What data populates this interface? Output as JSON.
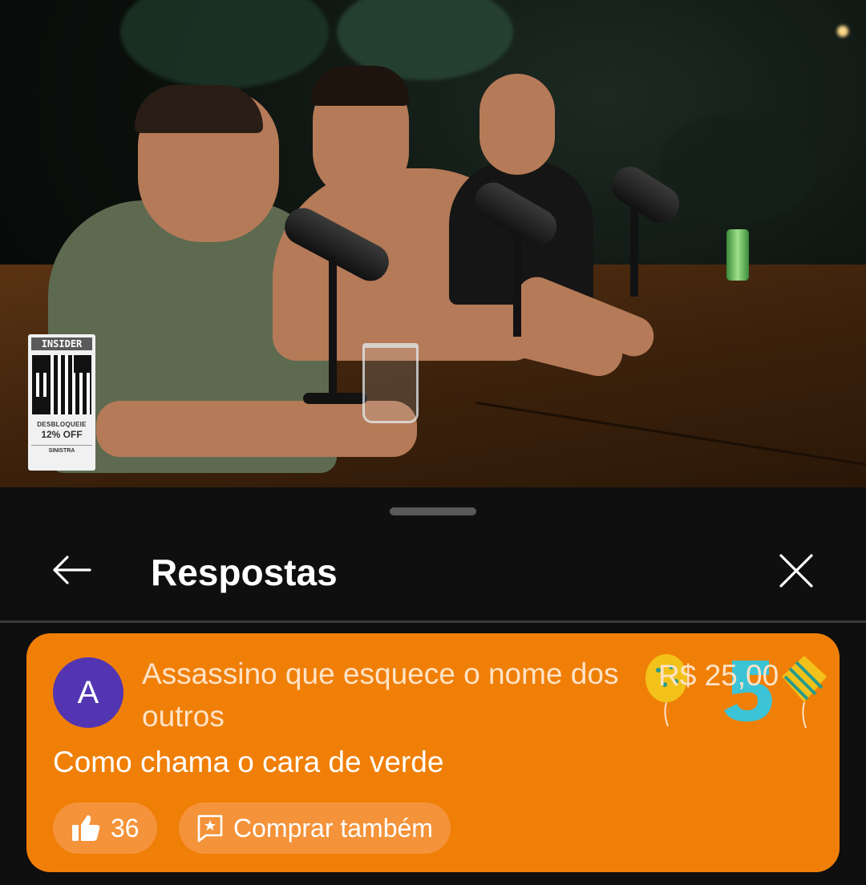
{
  "video": {
    "ad": {
      "brand": "INSIDER",
      "unlock_text": "DESBLOQUEIE",
      "discount": "12% OFF",
      "tag": "SINISTRA"
    }
  },
  "sheet": {
    "title": "Respostas"
  },
  "super_chat": {
    "avatar_letter": "A",
    "author": "Assassino que esquece o nome dos outros",
    "amount": "R$ 25,00",
    "message": "Como chama o cara de verde",
    "likes": "36",
    "buy_label": "Comprar também",
    "colors": {
      "card": "#f07f07",
      "avatar": "#5335b2"
    }
  },
  "icons": [
    "back-arrow-icon",
    "close-icon",
    "thumbs-up-icon",
    "super-chat-icon",
    "balloon-icon",
    "sticker-number-5-icon"
  ]
}
